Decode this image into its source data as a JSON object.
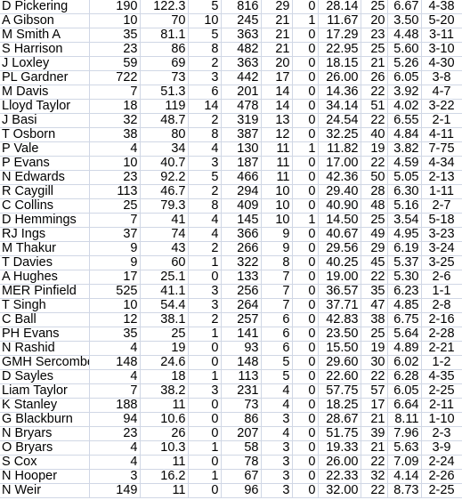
{
  "rows": [
    [
      "D Pickering",
      "190",
      "122.3",
      "5",
      "816",
      "29",
      "0",
      "28.14",
      "25",
      "6.67",
      "4-38"
    ],
    [
      "A Gibson",
      "10",
      "70",
      "10",
      "245",
      "21",
      "1",
      "11.67",
      "20",
      "3.50",
      "5-20"
    ],
    [
      "M Smith A",
      "35",
      "81.1",
      "5",
      "363",
      "21",
      "0",
      "17.29",
      "23",
      "4.48",
      "3-11"
    ],
    [
      "S Harrison",
      "23",
      "86",
      "8",
      "482",
      "21",
      "0",
      "22.95",
      "25",
      "5.60",
      "3-10"
    ],
    [
      "J Loxley",
      "59",
      "69",
      "2",
      "363",
      "20",
      "0",
      "18.15",
      "21",
      "5.26",
      "4-30"
    ],
    [
      "PL Gardner",
      "722",
      "73",
      "3",
      "442",
      "17",
      "0",
      "26.00",
      "26",
      "6.05",
      "3-8"
    ],
    [
      "M Davis",
      "7",
      "51.3",
      "6",
      "201",
      "14",
      "0",
      "14.36",
      "22",
      "3.92",
      "4-7"
    ],
    [
      "Lloyd Taylor",
      "18",
      "119",
      "14",
      "478",
      "14",
      "0",
      "34.14",
      "51",
      "4.02",
      "3-22"
    ],
    [
      "J Basi",
      "32",
      "48.7",
      "2",
      "319",
      "13",
      "0",
      "24.54",
      "22",
      "6.55",
      "2-1"
    ],
    [
      "T Osborn",
      "38",
      "80",
      "8",
      "387",
      "12",
      "0",
      "32.25",
      "40",
      "4.84",
      "4-11"
    ],
    [
      "P Vale",
      "4",
      "34",
      "4",
      "130",
      "11",
      "1",
      "11.82",
      "19",
      "3.82",
      "7-75"
    ],
    [
      "P Evans",
      "10",
      "40.7",
      "3",
      "187",
      "11",
      "0",
      "17.00",
      "22",
      "4.59",
      "4-34"
    ],
    [
      "N Edwards",
      "23",
      "92.2",
      "5",
      "466",
      "11",
      "0",
      "42.36",
      "50",
      "5.05",
      "2-13"
    ],
    [
      "R Caygill",
      "113",
      "46.7",
      "2",
      "294",
      "10",
      "0",
      "29.40",
      "28",
      "6.30",
      "1-11"
    ],
    [
      "C Collins",
      "25",
      "79.3",
      "8",
      "409",
      "10",
      "0",
      "40.90",
      "48",
      "5.16",
      "2-7"
    ],
    [
      "D Hemmings",
      "7",
      "41",
      "4",
      "145",
      "10",
      "1",
      "14.50",
      "25",
      "3.54",
      "5-18"
    ],
    [
      "RJ Ings",
      "37",
      "74",
      "4",
      "366",
      "9",
      "0",
      "40.67",
      "49",
      "4.95",
      "3-23"
    ],
    [
      "M Thakur",
      "9",
      "43",
      "2",
      "266",
      "9",
      "0",
      "29.56",
      "29",
      "6.19",
      "3-24"
    ],
    [
      "T Davies",
      "9",
      "60",
      "1",
      "322",
      "8",
      "0",
      "40.25",
      "45",
      "5.37",
      "3-25"
    ],
    [
      "A Hughes",
      "17",
      "25.1",
      "0",
      "133",
      "7",
      "0",
      "19.00",
      "22",
      "5.30",
      "2-6"
    ],
    [
      "MER Pinfield",
      "525",
      "41.1",
      "3",
      "256",
      "7",
      "0",
      "36.57",
      "35",
      "6.23",
      "1-1"
    ],
    [
      "T Singh",
      "10",
      "54.4",
      "3",
      "264",
      "7",
      "0",
      "37.71",
      "47",
      "4.85",
      "2-8"
    ],
    [
      "C Ball",
      "12",
      "38.1",
      "2",
      "257",
      "6",
      "0",
      "42.83",
      "38",
      "6.75",
      "2-16"
    ],
    [
      "PH Evans",
      "35",
      "25",
      "1",
      "141",
      "6",
      "0",
      "23.50",
      "25",
      "5.64",
      "2-28"
    ],
    [
      "N Rashid",
      "4",
      "19",
      "0",
      "93",
      "6",
      "0",
      "15.50",
      "19",
      "4.89",
      "2-21"
    ],
    [
      "GMH Sercombe",
      "148",
      "24.6",
      "0",
      "148",
      "5",
      "0",
      "29.60",
      "30",
      "6.02",
      "1-2"
    ],
    [
      "D Sayles",
      "4",
      "18",
      "1",
      "113",
      "5",
      "0",
      "22.60",
      "22",
      "6.28",
      "4-35"
    ],
    [
      "Liam Taylor",
      "7",
      "38.2",
      "3",
      "231",
      "4",
      "0",
      "57.75",
      "57",
      "6.05",
      "2-25"
    ],
    [
      "K Stanley",
      "188",
      "11",
      "0",
      "73",
      "4",
      "0",
      "18.25",
      "17",
      "6.64",
      "2-11"
    ],
    [
      "G Blackburn",
      "94",
      "10.6",
      "0",
      "86",
      "3",
      "0",
      "28.67",
      "21",
      "8.11",
      "1-10"
    ],
    [
      "N Bryars",
      "23",
      "26",
      "0",
      "207",
      "4",
      "0",
      "51.75",
      "39",
      "7.96",
      "2-3"
    ],
    [
      "O Bryars",
      "4",
      "10.3",
      "1",
      "58",
      "3",
      "0",
      "19.33",
      "21",
      "5.63",
      "3-9"
    ],
    [
      "S Cox",
      "4",
      "11",
      "0",
      "78",
      "3",
      "0",
      "26.00",
      "22",
      "7.09",
      "2-24"
    ],
    [
      "N Hooper",
      "3",
      "16.2",
      "1",
      "67",
      "3",
      "0",
      "22.33",
      "32",
      "4.14",
      "2-26"
    ],
    [
      "N Weir",
      "149",
      "11",
      "0",
      "96",
      "3",
      "0",
      "32.00",
      "22",
      "8.73",
      "2-25"
    ]
  ]
}
